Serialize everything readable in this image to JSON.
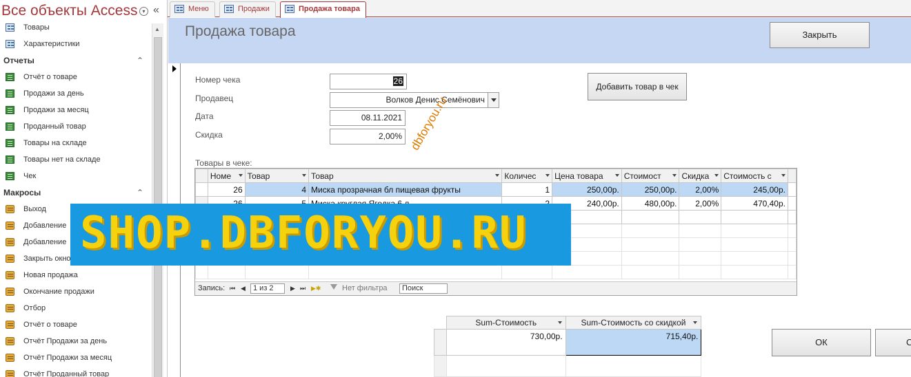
{
  "nav": {
    "title": "Все объекты Access",
    "collapse_glyph": "«",
    "top_items": [
      {
        "label": "Товары",
        "icon": "form-icon"
      },
      {
        "label": "Характеристики",
        "icon": "form-icon"
      }
    ],
    "groups": [
      {
        "title": "Отчеты",
        "items": [
          {
            "label": "Отчёт о товаре",
            "icon": "report-icon"
          },
          {
            "label": "Продажи за день",
            "icon": "report-icon"
          },
          {
            "label": "Продажи за месяц",
            "icon": "report-icon"
          },
          {
            "label": "Проданный товар",
            "icon": "report-icon"
          },
          {
            "label": "Товары на складе",
            "icon": "report-icon"
          },
          {
            "label": "Товары нет на складе",
            "icon": "report-icon"
          },
          {
            "label": "Чек",
            "icon": "report-icon"
          }
        ]
      },
      {
        "title": "Макросы",
        "items": [
          {
            "label": "Выход",
            "icon": "macro-icon"
          },
          {
            "label": "Добавление",
            "icon": "macro-icon"
          },
          {
            "label": "Добавление",
            "icon": "macro-icon"
          },
          {
            "label": "Закрыть окно",
            "icon": "macro-icon"
          },
          {
            "label": "Новая продажа",
            "icon": "macro-icon"
          },
          {
            "label": "Окончание продажи",
            "icon": "macro-icon"
          },
          {
            "label": "Отбор",
            "icon": "macro-icon"
          },
          {
            "label": "Отчёт о товаре",
            "icon": "macro-icon"
          },
          {
            "label": "Отчёт Продажи за день",
            "icon": "macro-icon"
          },
          {
            "label": "Отчёт Продажи за месяц",
            "icon": "macro-icon"
          },
          {
            "label": "Отчёт Проданный товар",
            "icon": "macro-icon"
          }
        ]
      }
    ]
  },
  "tabs": [
    {
      "label": "Меню",
      "active": false
    },
    {
      "label": "Продажи",
      "active": false
    },
    {
      "label": "Продажа товара",
      "active": true
    }
  ],
  "tab_close_glyph": "×",
  "form": {
    "title": "Продажа товара",
    "close_button": "Закрыть",
    "add_button": "Добавить товар в чек",
    "ok_button": "ОК",
    "extra_button": "С",
    "fields": {
      "receipt_number": {
        "label": "Номер чека",
        "value": "26"
      },
      "seller": {
        "label": "Продавец",
        "value": "Волков Денис Семёнович"
      },
      "date": {
        "label": "Дата",
        "value": "08.11.2021"
      },
      "discount": {
        "label": "Скидка",
        "value": "2,00%"
      }
    }
  },
  "items": {
    "label": "Товары в чеке:",
    "columns": [
      "Номе",
      "Товар",
      "Товар",
      "Количес",
      "Цена товара",
      "Стоимост",
      "Скидка",
      "Стоимость с"
    ],
    "rows": [
      [
        "26",
        "4",
        "Миска прозрачная бл пищевая фрукты",
        "1",
        "250,00р.",
        "250,00р.",
        "2,00%",
        "245,00р."
      ],
      [
        "26",
        "5",
        "Миска круглая Ягодка 6 л",
        "2",
        "240,00р.",
        "480,00р.",
        "2,00%",
        "470,40р."
      ]
    ],
    "navigator": {
      "record_label": "Запись:",
      "first": "⏮",
      "prev": "◀",
      "position": "1 из 2",
      "next": "▶",
      "last": "⏭",
      "new": "▶✱",
      "filter_label": "Нет фильтра",
      "search_placeholder": "Поиск"
    }
  },
  "totals": {
    "columns": [
      "Sum-Стоимость",
      "Sum-Стоимость со скидкой"
    ],
    "values": [
      "730,00р.",
      "715,40р."
    ]
  },
  "watermark": {
    "banner_text": "SHOP.DBFORYOU.RU",
    "diagonal_text": "dbforyou.ru"
  },
  "colors": {
    "accent": "#a4373a",
    "header_bg": "#c5d7f2",
    "selection": "#bcd8f5",
    "banner_bg": "#1899e0",
    "banner_text": "#f5d10e"
  }
}
